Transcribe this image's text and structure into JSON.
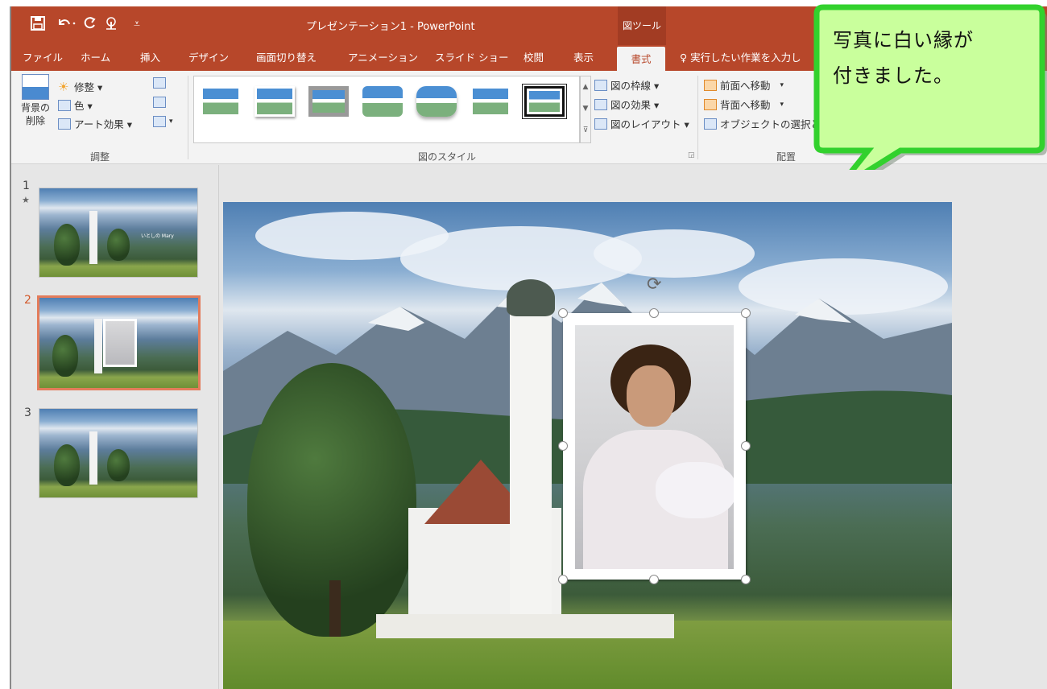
{
  "title_bar": {
    "document_title": "プレゼンテーション1 - PowerPoint",
    "context_tab_header": "図ツール",
    "quick_access_icons": [
      "save-icon",
      "undo-icon",
      "redo-icon",
      "touch-mode-icon",
      "customize-qat-icon"
    ]
  },
  "tabs": [
    {
      "label": "ファイル"
    },
    {
      "label": "ホーム"
    },
    {
      "label": "挿入"
    },
    {
      "label": "デザイン"
    },
    {
      "label": "画面切り替え"
    },
    {
      "label": "アニメーション"
    },
    {
      "label": "スライド ショー"
    },
    {
      "label": "校閲"
    },
    {
      "label": "表示"
    },
    {
      "label": "書式"
    }
  ],
  "active_tab": "書式",
  "tell_me": "実行したい作業を入力し",
  "ribbon": {
    "adjust": {
      "remove_bg_label": "背景の\n削除",
      "corrections": "修整 ▾",
      "color": "色 ▾",
      "artistic": "アート効果 ▾",
      "group_label": "調整"
    },
    "styles": {
      "border": "図の枠線 ▾",
      "effects": "図の効果 ▾",
      "layout": "図のレイアウト ▾",
      "group_label": "図のスタイル",
      "gallery_count": 7,
      "selected_index": 7
    },
    "arrange": {
      "bring_forward": "前面へ移動",
      "send_backward": "背面へ移動",
      "selection_pane": "オブジェクトの選択と",
      "group_label": "配置"
    }
  },
  "thumbnails": [
    {
      "number": "1",
      "marker": "★",
      "caption": "いとしの Mary",
      "selected": false
    },
    {
      "number": "2",
      "marker": "",
      "caption": "",
      "selected": true
    },
    {
      "number": "3",
      "marker": "",
      "caption": "",
      "selected": false
    }
  ],
  "callout": {
    "line1": "写真に白い縁が",
    "line2": "付きました。",
    "border_color": "#32d12d",
    "fill_color": "#c9ff9c"
  },
  "colors": {
    "accent": "#b7472a",
    "ribbon_bg": "#f3f3f3",
    "selection_border": "#e37c5b"
  }
}
